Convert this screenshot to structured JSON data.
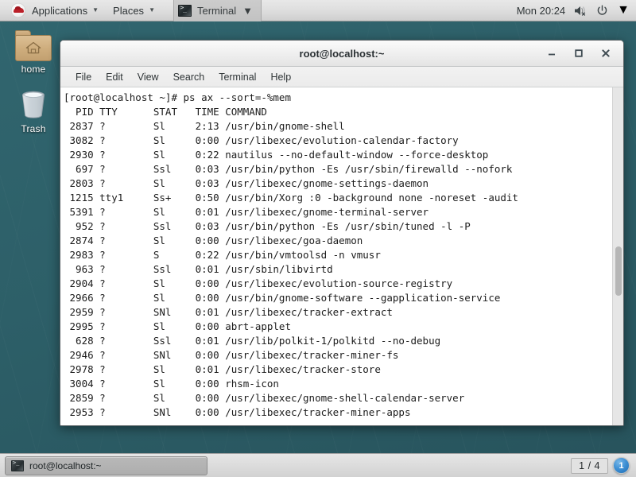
{
  "top_panel": {
    "logo_icon": "redhat-logo-icon",
    "applications_label": "Applications",
    "places_label": "Places",
    "terminal_window_label": "Terminal",
    "caret_glyph": "▼",
    "clock": "Mon 20:24",
    "volume_icon": "volume-muted-icon",
    "power_icon": "power-icon",
    "system_caret_glyph": "▼"
  },
  "desktop_icons": [
    {
      "name": "home",
      "label": "home",
      "icon": "home-folder-icon"
    },
    {
      "name": "trash",
      "label": "Trash",
      "icon": "trash-can-icon"
    }
  ],
  "terminal_window": {
    "title": "root@localhost:~",
    "minimize_glyph": "–",
    "maximize_glyph": "□",
    "close_glyph": "✕",
    "menus": [
      "File",
      "Edit",
      "View",
      "Search",
      "Terminal",
      "Help"
    ],
    "prompt_line": "[root@localhost ~]# ps ax --sort=-%mem",
    "header_line": "  PID TTY      STAT   TIME COMMAND",
    "process_lines": [
      " 2837 ?        Sl     2:13 /usr/bin/gnome-shell",
      " 3082 ?        Sl     0:00 /usr/libexec/evolution-calendar-factory",
      " 2930 ?        Sl     0:22 nautilus --no-default-window --force-desktop",
      "  697 ?        Ssl    0:03 /usr/bin/python -Es /usr/sbin/firewalld --nofork",
      " 2803 ?        Sl     0:03 /usr/libexec/gnome-settings-daemon",
      " 1215 tty1     Ss+    0:50 /usr/bin/Xorg :0 -background none -noreset -audit",
      " 5391 ?        Sl     0:01 /usr/libexec/gnome-terminal-server",
      "  952 ?        Ssl    0:03 /usr/bin/python -Es /usr/sbin/tuned -l -P",
      " 2874 ?        Sl     0:00 /usr/libexec/goa-daemon",
      " 2983 ?        S      0:22 /usr/bin/vmtoolsd -n vmusr",
      "  963 ?        Ssl    0:01 /usr/sbin/libvirtd",
      " 2904 ?        Sl     0:00 /usr/libexec/evolution-source-registry",
      " 2966 ?        Sl     0:00 /usr/bin/gnome-software --gapplication-service",
      " 2959 ?        SNl    0:01 /usr/libexec/tracker-extract",
      " 2995 ?        Sl     0:00 abrt-applet",
      "  628 ?        Ssl    0:01 /usr/lib/polkit-1/polkitd --no-debug",
      " 2946 ?        SNl    0:00 /usr/libexec/tracker-miner-fs",
      " 2978 ?        Sl     0:01 /usr/libexec/tracker-store",
      " 3004 ?        Sl     0:00 rhsm-icon",
      " 2859 ?        Sl     0:00 /usr/libexec/gnome-shell-calendar-server",
      " 2953 ?        SNl    0:00 /usr/libexec/tracker-miner-apps"
    ]
  },
  "bottom_panel": {
    "task_button_label": "root@localhost:~",
    "task_icon": "terminal-icon",
    "workspace_count_label": "1 / 4",
    "workspace_badge_label": "1"
  },
  "colors": {
    "desktop_background": "#2d5f68",
    "panel_background": "#dedede",
    "terminal_background": "#ffffff",
    "terminal_text": "#1c1c1c",
    "accent_blue": "#3d8fd4",
    "redhat_red": "#bb2029"
  }
}
